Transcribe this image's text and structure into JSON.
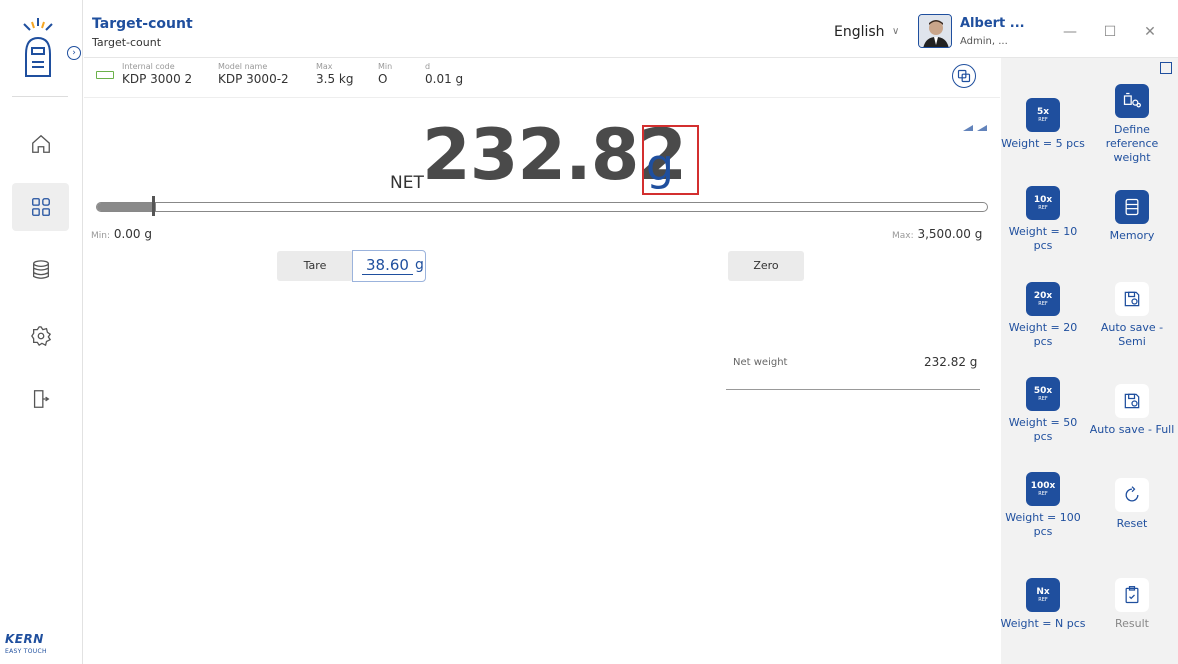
{
  "app": {
    "title": "Target-count",
    "subtitle": "Target-count"
  },
  "header": {
    "language": "English",
    "user_name": "Albert ...",
    "user_role": "Admin, ..."
  },
  "info": {
    "internal_code_label": "Internal code",
    "internal_code": "KDP 3000 2",
    "model_name_label": "Model name",
    "model_name": "KDP 3000-2",
    "max_label": "Max",
    "max": "3.5 kg",
    "min_label": "Min",
    "min": "O",
    "d_label": "d",
    "d": "0.01 g"
  },
  "reading": {
    "net_label": "NET",
    "value": "232.82",
    "unit": "g",
    "range_min_label": "Min:",
    "range_min": "0.00 g",
    "range_max_label": "Max:",
    "range_max": "3,500.00 g",
    "fill_fraction": 0.0665
  },
  "tare": {
    "label": "Tare",
    "value": "38.60",
    "unit": "g"
  },
  "zero": {
    "label": "Zero"
  },
  "summary": {
    "net_weight_label": "Net weight",
    "net_weight_value": "232.82 g"
  },
  "functions": {
    "w5": {
      "mult": "5x",
      "ref": "REF",
      "label": "Weight = 5 pcs"
    },
    "define": {
      "label": "Define reference weight"
    },
    "w10": {
      "mult": "10x",
      "ref": "REF",
      "label": "Weight = 10 pcs"
    },
    "memory": {
      "label": "Memory"
    },
    "w20": {
      "mult": "20x",
      "ref": "REF",
      "label": "Weight = 20 pcs"
    },
    "autosave_semi": {
      "label": "Auto save - Semi"
    },
    "w50": {
      "mult": "50x",
      "ref": "REF",
      "label": "Weight = 50 pcs"
    },
    "autosave_full": {
      "label": "Auto save - Full"
    },
    "w100": {
      "mult": "100x",
      "ref": "REF",
      "label": "Weight = 100 pcs"
    },
    "reset": {
      "label": "Reset"
    },
    "wn": {
      "mult": "Nx",
      "ref": "REF",
      "label": "Weight = N pcs"
    },
    "result": {
      "label": "Result"
    }
  },
  "brand": {
    "name": "KERN",
    "tagline": "EASY TOUCH"
  },
  "colors": {
    "accent": "#1f4f9e",
    "highlight": "#d32f2f",
    "panel": "#f2f2f2"
  }
}
